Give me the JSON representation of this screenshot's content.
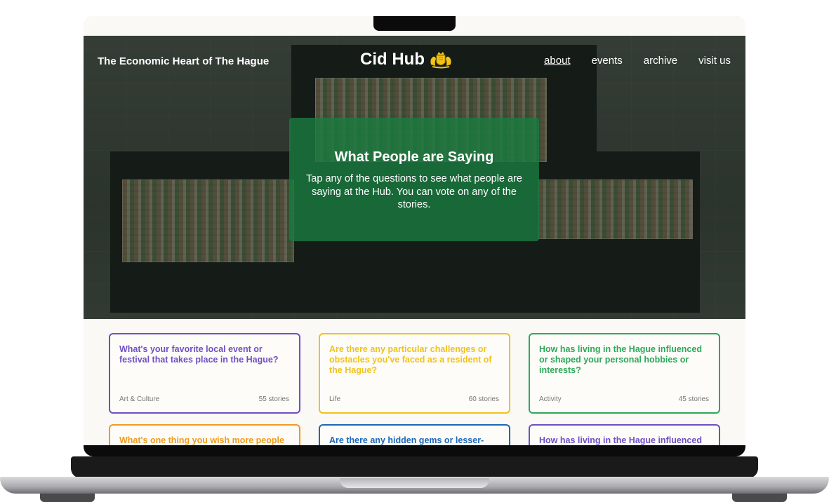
{
  "header": {
    "tagline": "The Economic Heart of The Hague",
    "brand_name": "Cid Hub",
    "brand_icon": "crest-icon",
    "nav": [
      {
        "label": "about",
        "active": true
      },
      {
        "label": "events",
        "active": false
      },
      {
        "label": "archive",
        "active": false
      },
      {
        "label": "visit us",
        "active": false
      }
    ]
  },
  "hero": {
    "title": "What People are Saying",
    "text": "Tap any of the questions to see what people are saying at the Hub. You can vote on any of the stories."
  },
  "cards": [
    {
      "question": "What's your favorite local event or festival that takes place in the Hague?",
      "category": "Art & Culture",
      "count": "55 stories",
      "color": "#6f4fc4"
    },
    {
      "question": "Are there any particular challenges or obstacles you've faced as a resident of the Hague?",
      "category": "Life",
      "count": "60 stories",
      "color": "#f0c21c"
    },
    {
      "question": "How has living in the Hague influenced or shaped your personal hobbies or interests?",
      "category": "Activity",
      "count": "45 stories",
      "color": "#2ea85a"
    },
    {
      "question": "What's one thing you wish more people",
      "category": "",
      "count": "",
      "color": "#ef9b1f"
    },
    {
      "question": "Are there any hidden gems or lesser-",
      "category": "",
      "count": "",
      "color": "#1f66b8"
    },
    {
      "question": "How has living in the Hague influenced",
      "category": "",
      "count": "",
      "color": "#6f4fc4"
    }
  ]
}
